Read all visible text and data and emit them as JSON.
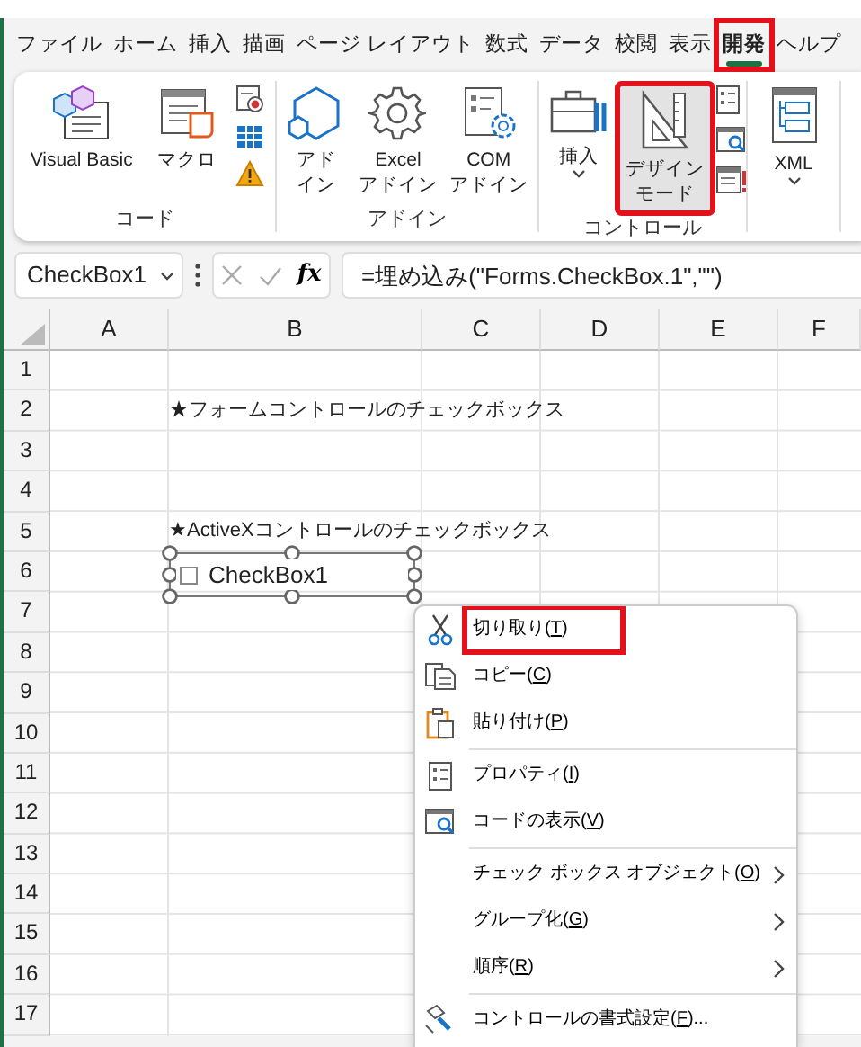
{
  "ribbon_tabs": [
    {
      "label": "ファイル",
      "selected": false,
      "highlighted": false
    },
    {
      "label": "ホーム",
      "selected": false,
      "highlighted": false
    },
    {
      "label": "挿入",
      "selected": false,
      "highlighted": false
    },
    {
      "label": "描画",
      "selected": false,
      "highlighted": false
    },
    {
      "label": "ページ レイアウト",
      "selected": false,
      "highlighted": false
    },
    {
      "label": "数式",
      "selected": false,
      "highlighted": false
    },
    {
      "label": "データ",
      "selected": false,
      "highlighted": false
    },
    {
      "label": "校閲",
      "selected": false,
      "highlighted": false
    },
    {
      "label": "表示",
      "selected": false,
      "highlighted": false
    },
    {
      "label": "開発",
      "selected": true,
      "highlighted": true
    },
    {
      "label": "ヘルプ",
      "selected": false,
      "highlighted": false
    }
  ],
  "ribbon_groups": [
    {
      "label": "コード",
      "commands": [
        {
          "kind": "large",
          "lines": [
            "Visual Basic"
          ],
          "pressed": false,
          "highlighted": false
        },
        {
          "kind": "large",
          "lines": [
            "マクロ"
          ],
          "pressed": false,
          "highlighted": false
        },
        {
          "kind": "stack"
        }
      ]
    },
    {
      "label": "アドイン",
      "commands": [
        {
          "kind": "large",
          "lines": [
            "アド",
            "イン"
          ],
          "pressed": false,
          "highlighted": false
        },
        {
          "kind": "large",
          "lines": [
            "Excel",
            "アドイン"
          ],
          "pressed": false,
          "highlighted": false
        },
        {
          "kind": "large",
          "lines": [
            "COM",
            "アドイン"
          ],
          "pressed": false,
          "highlighted": false
        }
      ]
    },
    {
      "label": "コントロール",
      "commands": [
        {
          "kind": "large",
          "lines": [
            "挿入"
          ],
          "dropdown": true,
          "pressed": false,
          "highlighted": false
        },
        {
          "kind": "large",
          "lines": [
            "デザイン",
            "モード"
          ],
          "pressed": true,
          "highlighted": true
        },
        {
          "kind": "stack"
        }
      ]
    },
    {
      "commands": [
        {
          "kind": "large",
          "lines": [
            "XML"
          ],
          "dropdown": true,
          "pressed": false,
          "highlighted": false
        }
      ]
    }
  ],
  "formula_bar": {
    "name_box": "CheckBox1",
    "function_label": "fx",
    "formula": "=埋め込み(\"Forms.CheckBox.1\",\"\")"
  },
  "sheet": {
    "columns": [
      "A",
      "B",
      "C",
      "D",
      "E",
      "F"
    ],
    "rows": [
      {
        "header": "1"
      },
      {
        "header": "2",
        "b_text": "★フォームコントロールのチェックボックス"
      },
      {
        "header": "3"
      },
      {
        "header": "4"
      },
      {
        "header": "5",
        "b_text": "★ActiveXコントロールのチェックボックス"
      },
      {
        "header": "6"
      },
      {
        "header": "7"
      },
      {
        "header": "8"
      },
      {
        "header": "9"
      },
      {
        "header": "10"
      },
      {
        "header": "11"
      },
      {
        "header": "12"
      },
      {
        "header": "13"
      },
      {
        "header": "14"
      },
      {
        "header": "15"
      },
      {
        "header": "16"
      },
      {
        "header": "17"
      }
    ]
  },
  "activex_checkbox": {
    "label": "CheckBox1",
    "checked": false,
    "selected": true
  },
  "context_menu": [
    {
      "kind": "command",
      "before": "切り取り(",
      "key": "T",
      "after": ")",
      "highlighted": true
    },
    {
      "kind": "command",
      "before": "コピー(",
      "key": "C",
      "after": ")",
      "highlighted": false
    },
    {
      "kind": "command",
      "before": "貼り付け(",
      "key": "P",
      "after": ")",
      "highlighted": false
    },
    {
      "kind": "separator"
    },
    {
      "kind": "command",
      "before": "プロパティ(",
      "key": "I",
      "after": ")",
      "highlighted": false
    },
    {
      "kind": "command",
      "before": "コードの表示(",
      "key": "V",
      "after": ")",
      "highlighted": false
    },
    {
      "kind": "separator"
    },
    {
      "kind": "submenu",
      "before": "チェック ボックス オブジェクト(",
      "key": "O",
      "after": ")",
      "highlighted": false
    },
    {
      "kind": "submenu",
      "before": "グループ化(",
      "key": "G",
      "after": ")",
      "highlighted": false
    },
    {
      "kind": "submenu",
      "before": "順序(",
      "key": "R",
      "after": ")",
      "highlighted": false
    },
    {
      "kind": "separator"
    },
    {
      "kind": "command",
      "before": "コントロールの書式設定(",
      "key": "F",
      "after": ")...",
      "highlighted": false
    }
  ]
}
